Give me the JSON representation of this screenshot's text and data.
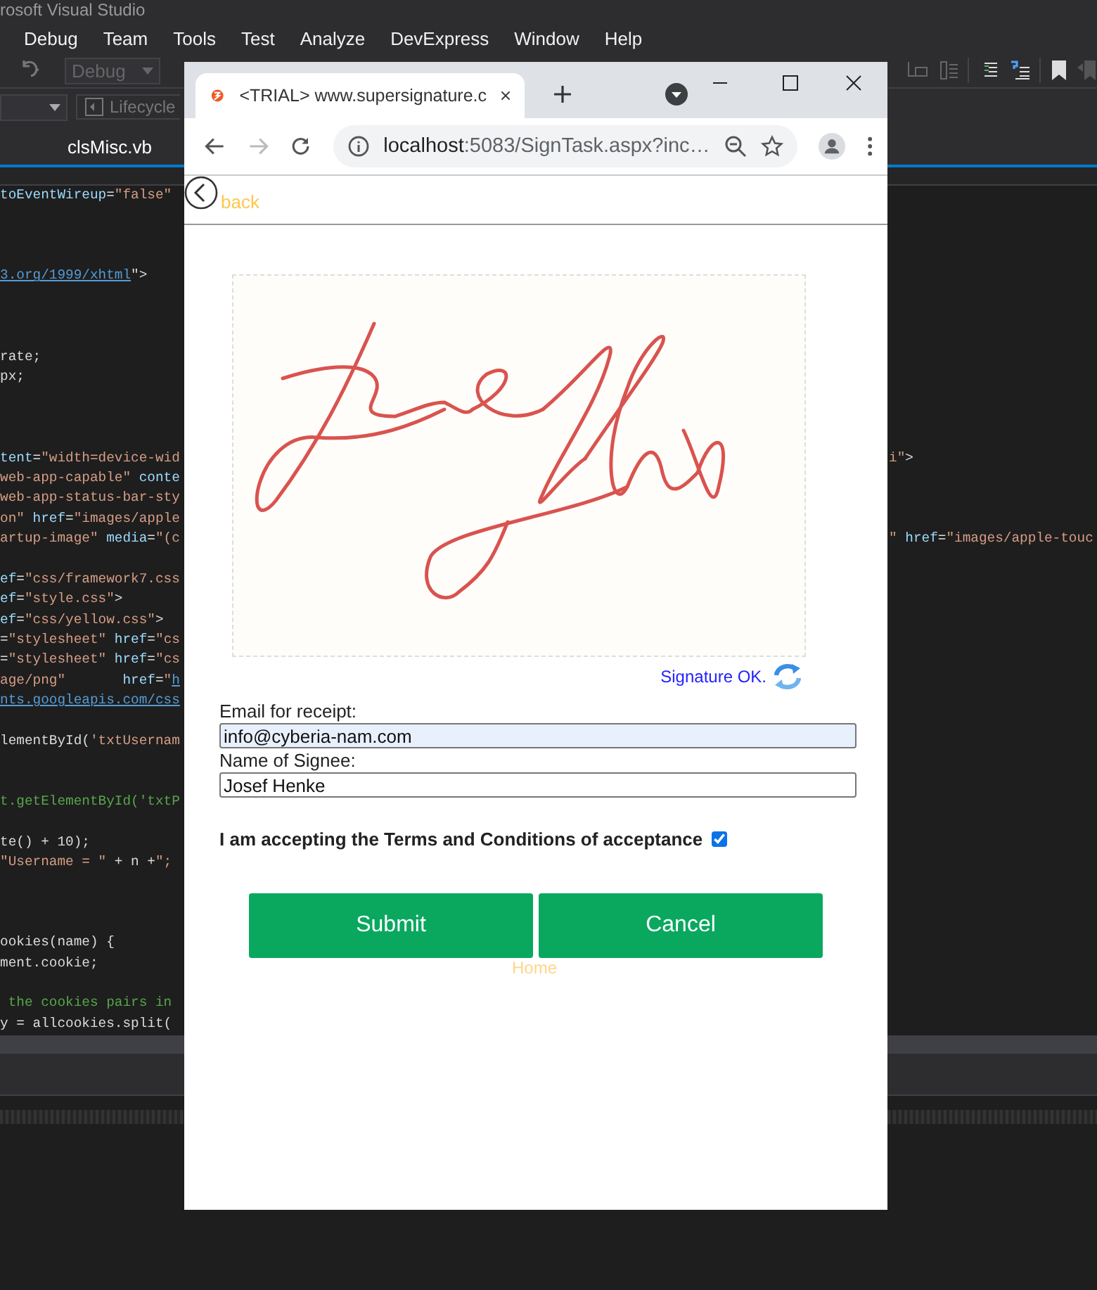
{
  "ide": {
    "title": "rosoft Visual Studio",
    "menu": [
      "Debug",
      "Team",
      "Tools",
      "Test",
      "Analyze",
      "DevExpress",
      "Window",
      "Help"
    ],
    "config_combo": "Debug",
    "lifecycle_button": "Lifecycle",
    "document_tab": "clsMisc.vb",
    "code_lines": [
      {
        "kind": "code",
        "left": [
          {
            "t": "toEventWireup",
            "kind": "attr"
          },
          {
            "t": "=",
            "kind": "plain"
          },
          {
            "t": "\"false\"",
            "kind": "string"
          }
        ]
      },
      {
        "kind": "blank"
      },
      {
        "kind": "blank"
      },
      {
        "kind": "blank"
      },
      {
        "kind": "code",
        "left": [
          {
            "t": "3.org/1999/xhtml",
            "kind": "link"
          },
          {
            "t": "\">",
            "kind": "plain"
          }
        ]
      },
      {
        "kind": "blank"
      },
      {
        "kind": "blank"
      },
      {
        "kind": "blank"
      },
      {
        "kind": "code",
        "left": [
          {
            "t": "rate;",
            "kind": "plain"
          }
        ]
      },
      {
        "kind": "code",
        "left": [
          {
            "t": "px;",
            "kind": "plain"
          }
        ]
      },
      {
        "kind": "blank"
      },
      {
        "kind": "blank"
      },
      {
        "kind": "blank"
      },
      {
        "kind": "code",
        "left": [
          {
            "t": "tent",
            "kind": "attr"
          },
          {
            "t": "=",
            "kind": "plain"
          },
          {
            "t": "\"width=device-wid",
            "kind": "string"
          }
        ],
        "right": [
          {
            "t": "i\"",
            "kind": "string"
          },
          {
            "t": ">",
            "kind": "plain"
          }
        ]
      },
      {
        "kind": "code",
        "left": [
          {
            "t": "web-app-capable\"",
            "kind": "string"
          },
          {
            "t": " conte",
            "kind": "attr"
          }
        ]
      },
      {
        "kind": "code",
        "left": [
          {
            "t": "web-app-status-bar-sty",
            "kind": "string"
          }
        ]
      },
      {
        "kind": "code",
        "left": [
          {
            "t": "on\"",
            "kind": "string"
          },
          {
            "t": " href",
            "kind": "attr"
          },
          {
            "t": "=",
            "kind": "plain"
          },
          {
            "t": "\"images/apple",
            "kind": "string"
          }
        ]
      },
      {
        "kind": "code",
        "left": [
          {
            "t": "artup-image\"",
            "kind": "string"
          },
          {
            "t": " media",
            "kind": "attr"
          },
          {
            "t": "=",
            "kind": "plain"
          },
          {
            "t": "\"(c",
            "kind": "string"
          }
        ],
        "right": [
          {
            "t": "\"",
            "kind": "string"
          },
          {
            "t": " href",
            "kind": "attr"
          },
          {
            "t": "=",
            "kind": "plain"
          },
          {
            "t": "\"images/apple-touc",
            "kind": "string"
          }
        ]
      },
      {
        "kind": "blank"
      },
      {
        "kind": "code",
        "left": [
          {
            "t": "ef",
            "kind": "attr"
          },
          {
            "t": "=",
            "kind": "plain"
          },
          {
            "t": "\"css/framework7.css",
            "kind": "string"
          }
        ]
      },
      {
        "kind": "code",
        "left": [
          {
            "t": "ef",
            "kind": "attr"
          },
          {
            "t": "=",
            "kind": "plain"
          },
          {
            "t": "\"style.css\"",
            "kind": "string"
          },
          {
            "t": ">",
            "kind": "plain"
          }
        ]
      },
      {
        "kind": "code",
        "left": [
          {
            "t": "ef",
            "kind": "attr"
          },
          {
            "t": "=",
            "kind": "plain"
          },
          {
            "t": "\"css/yellow.css\"",
            "kind": "string"
          },
          {
            "t": ">",
            "kind": "plain"
          }
        ]
      },
      {
        "kind": "code",
        "left": [
          {
            "t": "=",
            "kind": "plain"
          },
          {
            "t": "\"stylesheet\"",
            "kind": "string"
          },
          {
            "t": " href",
            "kind": "attr"
          },
          {
            "t": "=",
            "kind": "plain"
          },
          {
            "t": "\"cs",
            "kind": "string"
          }
        ]
      },
      {
        "kind": "code",
        "left": [
          {
            "t": "=",
            "kind": "plain"
          },
          {
            "t": "\"stylesheet\"",
            "kind": "string"
          },
          {
            "t": " href",
            "kind": "attr"
          },
          {
            "t": "=",
            "kind": "plain"
          },
          {
            "t": "\"cs",
            "kind": "string"
          }
        ]
      },
      {
        "kind": "code",
        "left": [
          {
            "t": "age/png\"",
            "kind": "string"
          },
          {
            "t": "       href",
            "kind": "attr"
          },
          {
            "t": "=",
            "kind": "plain"
          },
          {
            "t": "\"",
            "kind": "string"
          },
          {
            "t": "h",
            "kind": "link"
          }
        ]
      },
      {
        "kind": "code",
        "left": [
          {
            "t": "nts.googleapis.com/css",
            "kind": "link"
          }
        ]
      },
      {
        "kind": "blank"
      },
      {
        "kind": "code",
        "left": [
          {
            "t": "lementById(",
            "kind": "plain"
          },
          {
            "t": "'txtUsernam",
            "kind": "string"
          }
        ]
      },
      {
        "kind": "blank"
      },
      {
        "kind": "blank"
      },
      {
        "kind": "code",
        "left": [
          {
            "t": "t.getElementById('txtP",
            "kind": "comment"
          }
        ]
      },
      {
        "kind": "blank"
      },
      {
        "kind": "code",
        "left": [
          {
            "t": "te() + 10);",
            "kind": "plain"
          }
        ]
      },
      {
        "kind": "code",
        "left": [
          {
            "t": "\"Username = \"",
            "kind": "string"
          },
          {
            "t": " + n +",
            "kind": "plain"
          },
          {
            "t": "\";",
            "kind": "string"
          }
        ]
      },
      {
        "kind": "blank"
      },
      {
        "kind": "blank"
      },
      {
        "kind": "blank"
      },
      {
        "kind": "code",
        "left": [
          {
            "t": "ookies(name) {",
            "kind": "plain"
          }
        ]
      },
      {
        "kind": "code",
        "left": [
          {
            "t": "ment.cookie;",
            "kind": "plain"
          }
        ]
      },
      {
        "kind": "blank"
      },
      {
        "kind": "code",
        "left": [
          {
            "t": " the cookies pairs in",
            "kind": "comment"
          }
        ]
      },
      {
        "kind": "code",
        "left": [
          {
            "t": "y = allcookies.split(",
            "kind": "plain"
          }
        ]
      }
    ]
  },
  "browser": {
    "tab_title": "<TRIAL> www.supersignature.c",
    "url_host": "localhost",
    "url_rest": ":5083/SignTask.aspx?inc…",
    "page": {
      "back_link": "back",
      "signature_status": "Signature OK.",
      "fields": [
        {
          "label": "Email for receipt:",
          "value": "info@cyberia-nam.com",
          "autofilled": true
        },
        {
          "label": "Name of Signee:",
          "value": "Josef Henke",
          "autofilled": false
        }
      ],
      "terms": {
        "label": "I am accepting the Terms and Conditions of acceptance",
        "checked": true
      },
      "buttons": [
        "Submit",
        "Cancel"
      ],
      "home_link": "Home"
    }
  }
}
